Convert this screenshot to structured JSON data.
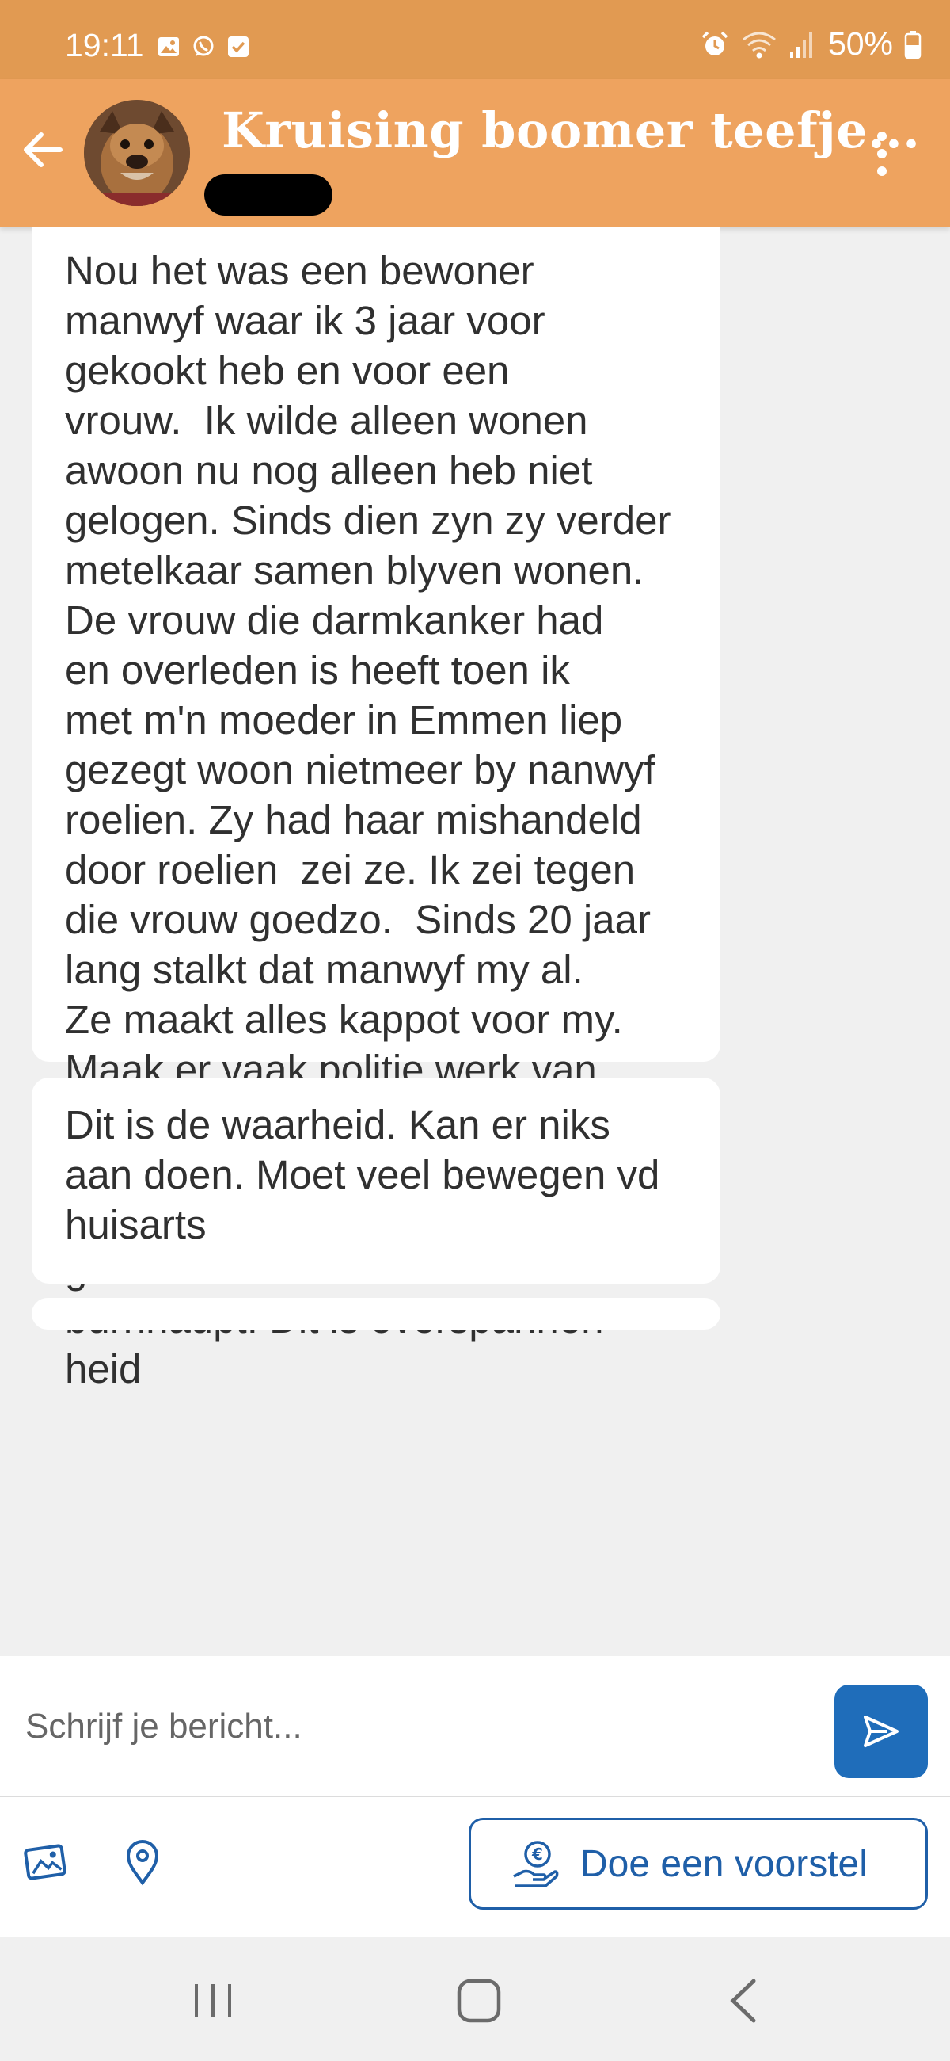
{
  "status_bar": {
    "time": "19:11",
    "battery": "50%",
    "left_icons": [
      "gallery-icon",
      "whatsapp-icon",
      "check-icon"
    ],
    "right_icons": [
      "alarm-icon",
      "wifi-icon",
      "signal-icon",
      "battery-icon"
    ]
  },
  "header": {
    "title": "Kruising boomer teefje...",
    "accent_color": "#eea35f"
  },
  "messages": [
    {
      "text": "Nou het was een bewoner\nmanwyf waar ik 3 jaar voor\ngekookt heb en voor een\nvrouw.  Ik wilde alleen wonen\nawoon nu nog alleen heb niet\ngelogen. Sinds dien zyn zy verder\nmetelkaar samen blyven wonen.\nDe vrouw die darmkanker had\nen overleden is heeft toen ik\nmet m'n moeder in Emmen liep\ngezegt woon nietmeer by nanwyf\nroelien. Zy had haar mishandeld\ndoor roelien  zei ze. Ik zei tegen\ndie vrouw goedzo.  Sinds 20 jaar\nlang stalkt dat manwyf my al.\nZe maakt alles kappot voor my.\nMaak er vaak politie werk van\nEnigste wat ik kan doen voor\nbescherming van alles van my.\nHeb op het moment vh gemene\ngeklets wat ik soms hoor een\nburnhaupt. Dit is overspannen\nheid"
    },
    {
      "text": "Dit is de waarheid. Kan er niks\naan doen. Moet veel bewegen vd\nhuisarts"
    }
  ],
  "composer": {
    "placeholder": "Schrijf je bericht...",
    "send_color": "#1f6dba"
  },
  "actions": {
    "offer_label": "Doe een voorstel",
    "offer_color": "#1f5fa8"
  }
}
